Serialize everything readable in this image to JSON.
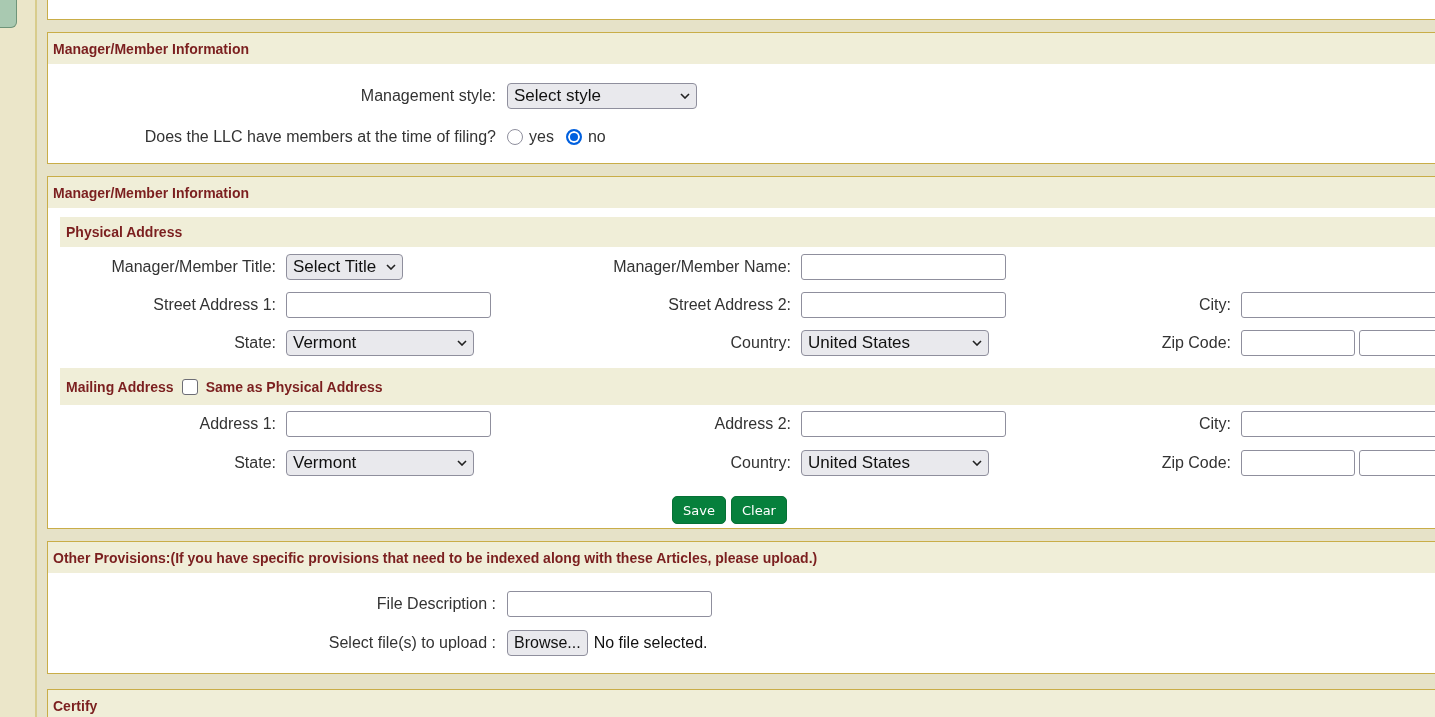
{
  "sections": [
    {
      "kind": "fields",
      "title": "Manager/Member Information",
      "rows": [
        {
          "kind": "select",
          "label": "Management style:",
          "value": "Select style"
        },
        {
          "kind": "radio",
          "label": "Does the LLC have members at the time of filing?",
          "options": [
            {
              "label": "yes",
              "selected": false
            },
            {
              "label": "no",
              "selected": true
            }
          ]
        }
      ]
    },
    {
      "kind": "address",
      "title": "Manager/Member Information",
      "groups": [
        {
          "title": "Physical Address",
          "rows": [
            [
              {
                "kind": "select",
                "label": "Manager/Member Title:",
                "value": "Select Title"
              },
              {
                "kind": "text",
                "label": "Manager/Member Name:"
              }
            ],
            [
              {
                "kind": "text",
                "label": "Street Address 1:"
              },
              {
                "kind": "text",
                "label": "Street Address 2:"
              },
              {
                "kind": "text",
                "label": "City:"
              }
            ],
            [
              {
                "kind": "select",
                "label": "State:",
                "value": "Vermont"
              },
              {
                "kind": "select",
                "label": "Country:",
                "value": "United States"
              },
              {
                "kind": "zip",
                "label": "Zip Code:"
              }
            ]
          ]
        },
        {
          "title": "Mailing Address",
          "checkbox": {
            "label": "Same as Physical Address",
            "checked": false
          },
          "rows": [
            [
              {
                "kind": "text",
                "label": "Address 1:"
              },
              {
                "kind": "text",
                "label": "Address 2:"
              },
              {
                "kind": "text",
                "label": "City:"
              }
            ],
            [
              {
                "kind": "select",
                "label": "State:",
                "value": "Vermont"
              },
              {
                "kind": "select",
                "label": "Country:",
                "value": "United States"
              },
              {
                "kind": "zip",
                "label": "Zip Code:"
              }
            ]
          ]
        }
      ],
      "buttons": [
        "Save",
        "Clear"
      ]
    },
    {
      "kind": "fields",
      "title": "Other Provisions:(If you have specific provisions that need to be indexed along with these Articles, please upload.)",
      "rows": [
        {
          "kind": "text",
          "label": "File Description :"
        },
        {
          "kind": "file",
          "label": "Select file(s) to upload :",
          "button": "Browse...",
          "status": "No file selected."
        }
      ]
    },
    {
      "kind": "fields",
      "title": "Certify"
    }
  ]
}
